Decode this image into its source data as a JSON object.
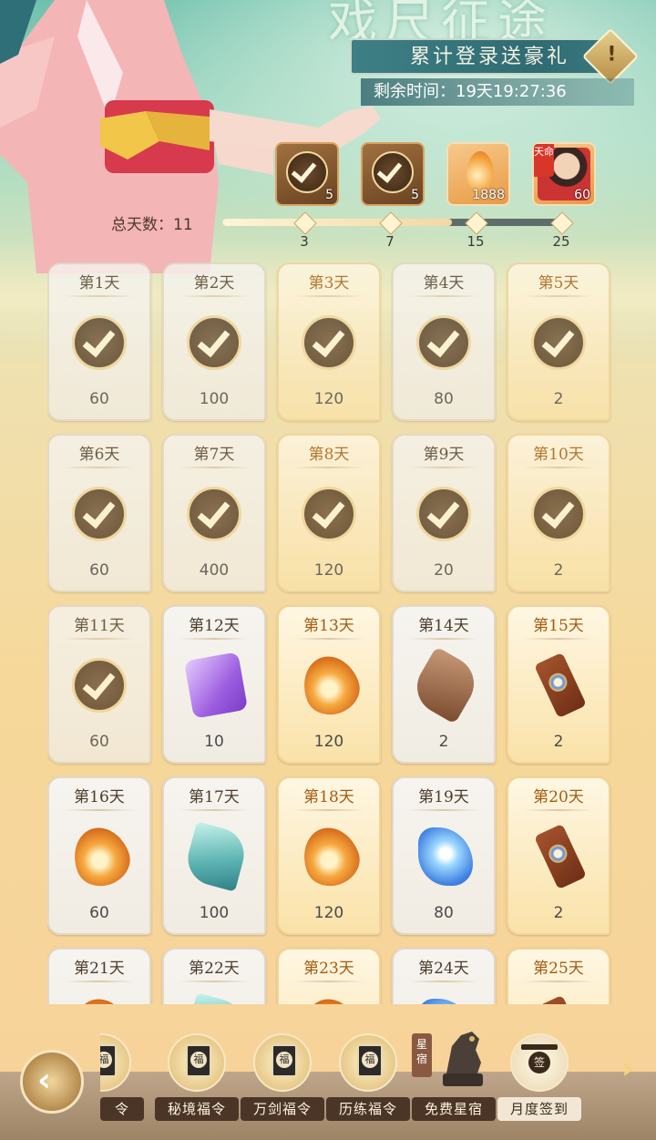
{
  "header": {
    "title_art": "戏尺征途",
    "banner_text": "累计登录送豪礼",
    "alert_icon": "!",
    "timer_label": "剩余时间：",
    "timer_value": "19天19:27:36"
  },
  "milestone_rewards": [
    {
      "icon": "check-icon",
      "count": "5",
      "claimed": true
    },
    {
      "icon": "check-icon",
      "count": "5",
      "claimed": true
    },
    {
      "icon": "flame-feather-icon",
      "count": "1888",
      "claimed": false
    },
    {
      "icon": "hero-portrait-icon",
      "tag": "天命",
      "count": "60",
      "claimed": false
    }
  ],
  "progress": {
    "label": "总天数：",
    "value": "11",
    "fraction": 0.67,
    "nodes": [
      "3",
      "7",
      "15",
      "25"
    ]
  },
  "days": [
    {
      "label": "第1天",
      "qty": "60",
      "claimed": true,
      "gold": false,
      "icon": "check-icon"
    },
    {
      "label": "第2天",
      "qty": "100",
      "claimed": true,
      "gold": false,
      "icon": "check-icon"
    },
    {
      "label": "第3天",
      "qty": "120",
      "claimed": true,
      "gold": true,
      "icon": "check-icon"
    },
    {
      "label": "第4天",
      "qty": "80",
      "claimed": true,
      "gold": false,
      "icon": "check-icon"
    },
    {
      "label": "第5天",
      "qty": "2",
      "claimed": true,
      "gold": true,
      "icon": "check-icon"
    },
    {
      "label": "第6天",
      "qty": "60",
      "claimed": true,
      "gold": false,
      "icon": "check-icon"
    },
    {
      "label": "第7天",
      "qty": "400",
      "claimed": true,
      "gold": false,
      "icon": "check-icon"
    },
    {
      "label": "第8天",
      "qty": "120",
      "claimed": true,
      "gold": true,
      "icon": "check-icon"
    },
    {
      "label": "第9天",
      "qty": "20",
      "claimed": true,
      "gold": false,
      "icon": "check-icon"
    },
    {
      "label": "第10天",
      "qty": "2",
      "claimed": true,
      "gold": true,
      "icon": "check-icon"
    },
    {
      "label": "第11天",
      "qty": "60",
      "claimed": true,
      "gold": false,
      "icon": "check-icon"
    },
    {
      "label": "第12天",
      "qty": "10",
      "claimed": false,
      "gold": false,
      "icon": "scroll-item"
    },
    {
      "label": "第13天",
      "qty": "120",
      "claimed": false,
      "gold": true,
      "icon": "flame-item"
    },
    {
      "label": "第14天",
      "qty": "2",
      "claimed": false,
      "gold": false,
      "icon": "relic-item"
    },
    {
      "label": "第15天",
      "qty": "2",
      "claimed": false,
      "gold": true,
      "icon": "talisman-item"
    },
    {
      "label": "第16天",
      "qty": "60",
      "claimed": false,
      "gold": false,
      "icon": "flame-item"
    },
    {
      "label": "第17天",
      "qty": "100",
      "claimed": false,
      "gold": false,
      "icon": "jade-item"
    },
    {
      "label": "第18天",
      "qty": "120",
      "claimed": false,
      "gold": true,
      "icon": "flame-item"
    },
    {
      "label": "第19天",
      "qty": "80",
      "claimed": false,
      "gold": false,
      "icon": "crystal-item"
    },
    {
      "label": "第20天",
      "qty": "2",
      "claimed": false,
      "gold": true,
      "icon": "talisman-item"
    },
    {
      "label": "第21天",
      "qty": "",
      "claimed": false,
      "gold": false,
      "icon": "flame-item"
    },
    {
      "label": "第22天",
      "qty": "",
      "claimed": false,
      "gold": false,
      "icon": "jade-item"
    },
    {
      "label": "第23天",
      "qty": "",
      "claimed": false,
      "gold": true,
      "icon": "flame-item"
    },
    {
      "label": "第24天",
      "qty": "",
      "claimed": false,
      "gold": false,
      "icon": "crystal-item"
    },
    {
      "label": "第25天",
      "qty": "",
      "claimed": false,
      "gold": true,
      "icon": "talisman-item"
    }
  ],
  "bottom_nav": {
    "tabs": [
      {
        "label": "令",
        "icon": "book-fu-icon"
      },
      {
        "label": "秘境福令",
        "icon": "book-fu-icon"
      },
      {
        "label": "万剑福令",
        "icon": "book-fu-icon"
      },
      {
        "label": "历练福令",
        "icon": "book-fu-icon"
      },
      {
        "label": "免费星宿",
        "icon": "star-beast-icon",
        "tag": "星宿"
      },
      {
        "label": "月度签到",
        "icon": "sign-in-icon",
        "active": true
      }
    ],
    "fu_char": "福",
    "sign_char": "签"
  },
  "colors": {
    "gold_card": "#fae2a8",
    "plain_card": "#f1ece2",
    "banner": "#2f6b73"
  }
}
